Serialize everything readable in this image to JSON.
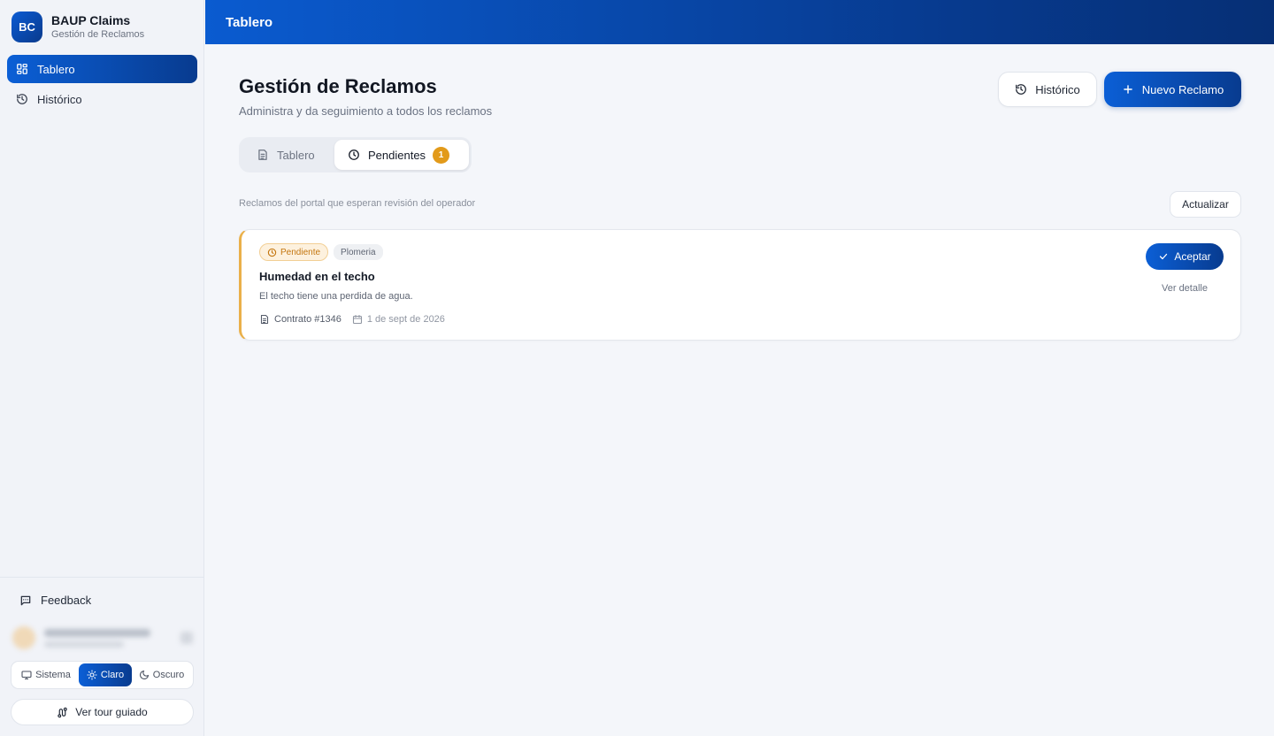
{
  "brand": {
    "logo": "BC",
    "title": "BAUP Claims",
    "subtitle": "Gestión de Reclamos"
  },
  "sidebar": {
    "items": [
      {
        "label": "Tablero",
        "icon": "dashboard-icon",
        "active": true
      },
      {
        "label": "Histórico",
        "icon": "history-icon",
        "active": false
      }
    ],
    "feedback": {
      "label": "Feedback",
      "icon": "message-square-icon"
    },
    "theme": {
      "options": [
        {
          "label": "Sistema",
          "icon": "monitor-icon"
        },
        {
          "label": "Claro",
          "icon": "sun-icon"
        },
        {
          "label": "Oscuro",
          "icon": "moon-icon"
        }
      ],
      "selected": "Claro"
    },
    "tour": {
      "label": "Ver tour guiado",
      "icon": "route-icon"
    }
  },
  "topbar": {
    "title": "Tablero"
  },
  "header": {
    "title": "Gestión de Reclamos",
    "subtitle": "Administra y da seguimiento a todos los reclamos",
    "history_button": "Histórico",
    "new_button": "Nuevo Reclamo"
  },
  "tabs": [
    {
      "label": "Tablero",
      "icon": "file-list-icon",
      "active": false
    },
    {
      "label": "Pendientes",
      "icon": "clock-icon",
      "active": true,
      "badge": "1"
    }
  ],
  "pending": {
    "hint": "Reclamos del portal que esperan revisión del operador",
    "refresh_button": "Actualizar",
    "claims": [
      {
        "status": "Pendiente",
        "category": "Plomeria",
        "title": "Humedad en el techo",
        "description": "El techo tiene una perdida de agua.",
        "contract": "Contrato #1346",
        "date": "1 de sept de 2026",
        "accept_label": "Aceptar",
        "detail_label": "Ver detalle"
      }
    ]
  },
  "colors": {
    "primary": "#0b5fd6",
    "primary_dark": "#083b8f",
    "pending_accent": "#eab04a",
    "badge_orange": "#e29a1a"
  }
}
